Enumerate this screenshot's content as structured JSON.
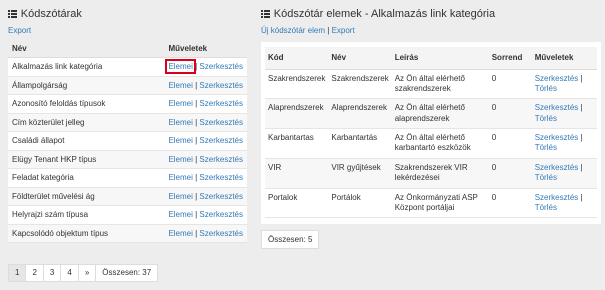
{
  "left": {
    "title": "Kódszótárak",
    "export": "Export",
    "col_name": "Név",
    "col_actions": "Műveletek",
    "action_items": "Elemei",
    "action_sep": " | ",
    "action_edit": "Szerkesztés",
    "rows": [
      "Alkalmazás link kategória",
      "Állampolgárság",
      "Azonosító feloldás típusok",
      "Cím közterület jelleg",
      "Családi állapot",
      "Elügy Tenant HKP típus",
      "Feladat kategória",
      "Földterület művelési ág",
      "Helyrajzi szám típusa",
      "Kapcsolódó objektum típus"
    ]
  },
  "pager": {
    "pages": [
      "1",
      "2",
      "3",
      "4",
      "»"
    ],
    "active": "1",
    "total": "Összesen: 37"
  },
  "right": {
    "title": "Kódszótár elemek - Alkalmazás link kategória",
    "new_item": "Új kódszótár elem",
    "sep": " | ",
    "export": "Export",
    "headers": [
      "Kód",
      "Név",
      "Leírás",
      "Sorrend",
      "Műveletek"
    ],
    "action_edit": "Szerkesztés",
    "action_sep": " | ",
    "action_delete": "Törlés",
    "rows": [
      {
        "kod": "Szakrendszerek",
        "nev": "Szakrendszerek",
        "leiras": "Az Ön által elérhető szakrendszerek",
        "sorrend": "0"
      },
      {
        "kod": "Alaprendszerek",
        "nev": "Alaprendszerek",
        "leiras": "Az Ön által elérhető alaprendszerek",
        "sorrend": "0"
      },
      {
        "kod": "Karbantartas",
        "nev": "Karbantartás",
        "leiras": "Az Ön által elérhető karbantartó eszközök",
        "sorrend": "0"
      },
      {
        "kod": "VIR",
        "nev": "VIR gyűjtések",
        "leiras": "Szakrendszerek VIR lekérdezései",
        "sorrend": "0"
      },
      {
        "kod": "Portalok",
        "nev": "Portálok",
        "leiras": "Az Önkormányzati ASP Központ portáljai",
        "sorrend": "0"
      }
    ],
    "total": "Összesen: 5"
  }
}
